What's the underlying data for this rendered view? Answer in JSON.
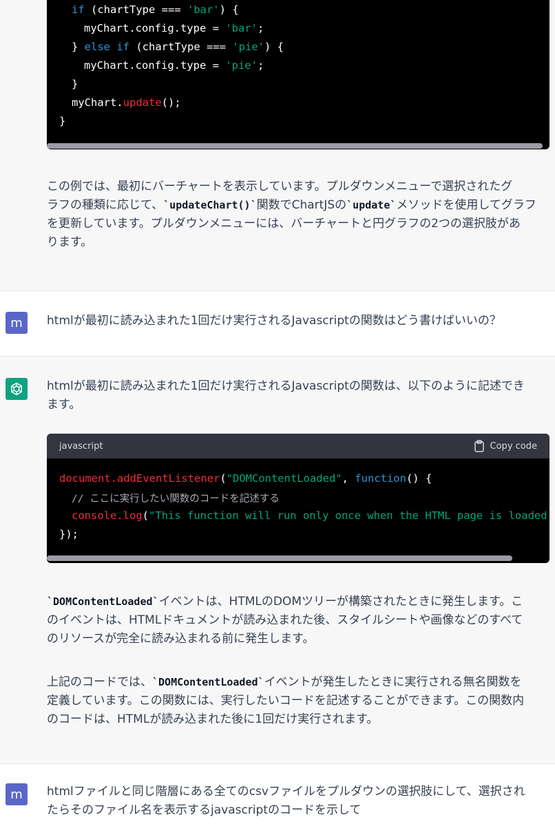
{
  "top_code": {
    "lines": [
      [
        "if",
        " (chartType === ",
        "'bar'",
        ") {"
      ],
      [
        "myChart.config.type = ",
        "'bar'",
        ";"
      ],
      [
        "} ",
        "else if",
        " (chartType === ",
        "'pie'",
        ") {"
      ],
      [
        "myChart.config.type = ",
        "'pie'",
        ";"
      ],
      [
        "}"
      ],
      [
        "myChart.",
        "update",
        "();"
      ],
      [
        "}"
      ]
    ]
  },
  "para1": {
    "line1": "この例では、最初にバーチャートを表示しています。プルダウンメニューで選択されたグ",
    "line2_a": "ラフの種類に応じて、",
    "line2_code": "`updateChart()`",
    "line2_b": "関数でChartJSの",
    "line2_code2": "`update`",
    "line2_c": "メソッドを使用してグラフ",
    "line3": "を更新しています。プルダウンメニューには、バーチャートと円グラフの2つの選択肢があ",
    "line4": "ります。"
  },
  "user_msg1": {
    "avatar": "m",
    "text": "htmlが最初に読み込まれた1回だけ実行されるJavascriptの関数はどう書けばいいの？"
  },
  "assistant_msg": {
    "intro_line1": "htmlが最初に読み込まれた1回だけ実行されるJavascriptの関数は、以下のように記述でき",
    "intro_line2": "ます。",
    "code_lang": "javascript",
    "copy_label": "Copy code",
    "code": {
      "l1_obj": "document.",
      "l1_fn": "addEventListener",
      "l1_p1": "(",
      "l1_str": "\"DOMContentLoaded\"",
      "l1_p2": ", ",
      "l1_kw": "function",
      "l1_p3": "() {",
      "l2_comment": "// ここに実行したい関数のコードを記述する",
      "l3_obj": "console.",
      "l3_fn": "log",
      "l3_p1": "(",
      "l3_str": "\"This function will run only once when the HTML page is loaded",
      "l4": "});"
    },
    "p2_code": "`DOMContentLoaded`",
    "p2_line1": "イベントは、HTMLのDOMツリーが構築されたときに発生します。こ",
    "p2_line2": "のイベントは、HTMLドキュメントが読み込まれた後、スタイルシートや画像などのすべて",
    "p2_line3": "のリソースが完全に読み込まれる前に発生します。",
    "p3_a": "上記のコードでは、",
    "p3_code": "`DOMContentLoaded`",
    "p3_b": "イベントが発生したときに実行される無名関数を",
    "p3_line2": "定義しています。この関数には、実行したいコードを記述することができます。この関数内",
    "p3_line3": "のコードは、HTMLが読み込まれた後に1回だけ実行されます。"
  },
  "user_msg2": {
    "avatar": "m",
    "line1": "htmlファイルと同じ階層にある全てのcsvファイルをプルダウンの選択肢にして、選択され",
    "line2": "たらそのファイル名を表示するjavascriptのコードを示して"
  },
  "colors": {
    "keyword": "#2e95d3",
    "string": "#00a67d",
    "function": "#f22c3d",
    "assistant_bg": "#f7f7f8",
    "user_avatar": "#5a67c8",
    "bot_avatar": "#10a37f"
  }
}
